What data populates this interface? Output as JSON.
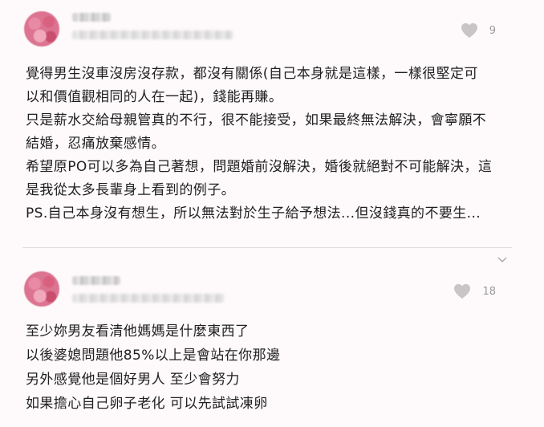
{
  "comments": [
    {
      "like_count": "9",
      "lines": [
        "覺得男生沒車沒房沒存款，都沒有關係(自己本身就是這樣，一樣很堅定可",
        "以和價值觀相同的人在一起)，錢能再賺。",
        "只是薪水交給母親管真的不行，很不能接受，如果最終無法解決，會寧願不",
        "結婚，忍痛放棄感情。",
        "希望原PO可以多為自己著想，問題婚前沒解決，婚後就絕對不可能解決，這",
        "是我從太多長輩身上看到的例子。",
        "PS.自己本身沒有想生，所以無法對於生子給予想法...但沒錢真的不要生..."
      ]
    },
    {
      "like_count": "18",
      "lines": [
        "至少妳男友看清他媽媽是什麼東西了",
        "以後婆媳問題他85%以上是會站在你那邊",
        "另外感覺他是個好男人 至少會努力",
        "如果擔心自己卵子老化 可以先試試凍卵"
      ]
    }
  ],
  "colors": {
    "background": "#fefafb",
    "text": "#202020",
    "heart": "#c9c5c7",
    "count": "#9a9a9a"
  },
  "icons": {
    "like": "heart-icon",
    "expand": "chevron-down-icon"
  }
}
